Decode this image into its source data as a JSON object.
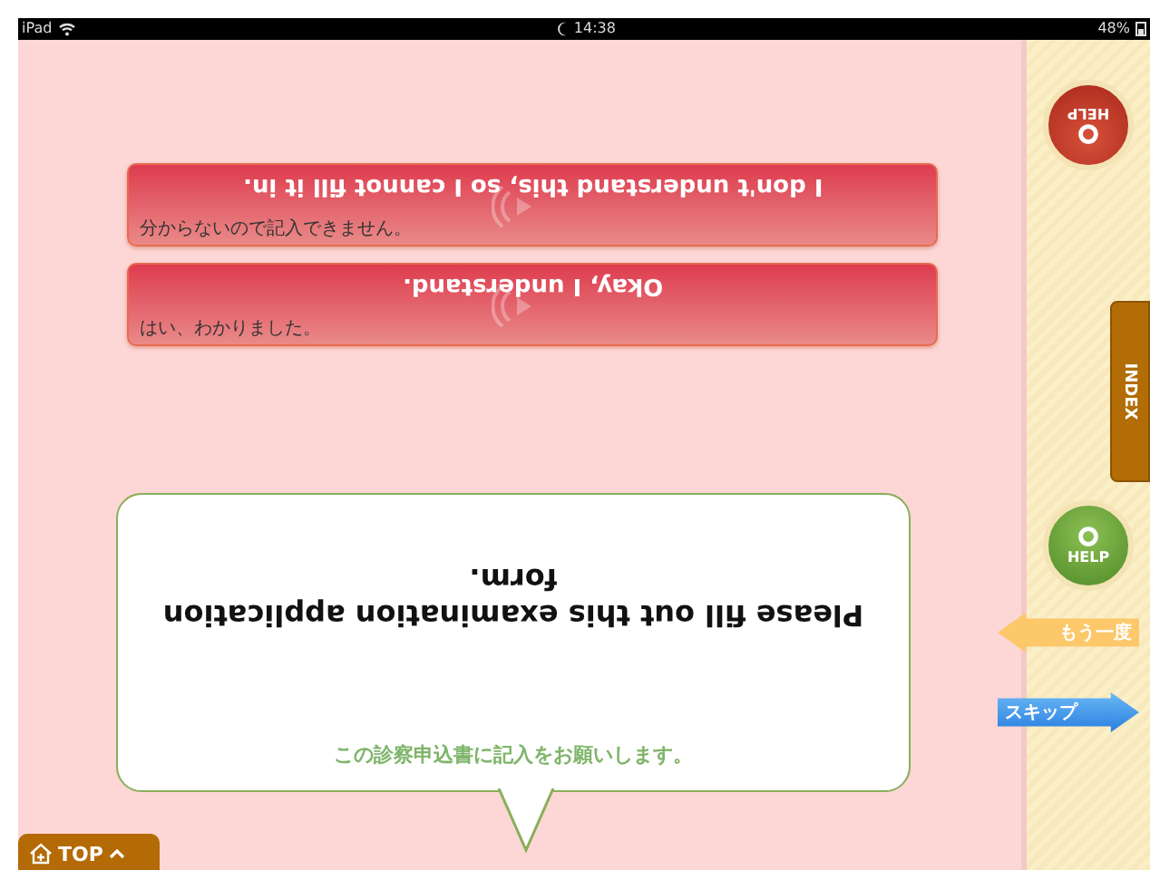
{
  "status_bar": {
    "device": "iPad",
    "time": "14:38",
    "battery": "48%"
  },
  "phrases": [
    {
      "english": "I don't understand this, so I cannot fill it in.",
      "japanese": "分からないので記入できません。",
      "inverted": true
    },
    {
      "english": "Okay, I understand.",
      "japanese": "はい、わかりました。",
      "inverted": true
    }
  ],
  "prompt": {
    "english": "Please fill out this examination application form.",
    "japanese": "この診察申込書に記入をお願いします。",
    "inverted": true
  },
  "sidebar": {
    "help_top": {
      "label": "HELP",
      "inverted": true
    },
    "index_tab": "INDEX",
    "help": {
      "label": "HELP",
      "inverted": false
    },
    "repeat_button": "もう一度",
    "skip_button": "スキップ"
  },
  "top_button": "TOP"
}
